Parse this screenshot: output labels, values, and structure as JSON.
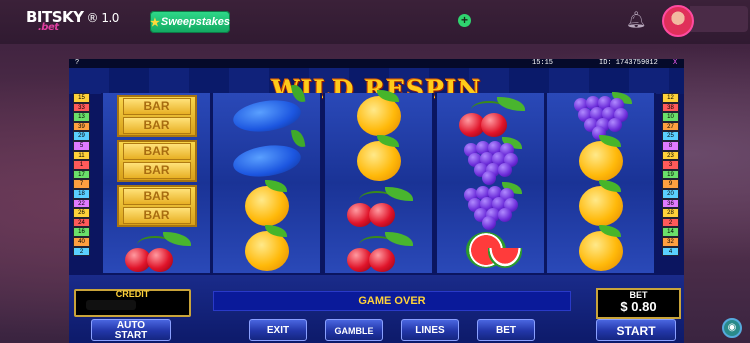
{
  "header": {
    "logo_main": "BITSKY",
    "logo_sub": ".bet",
    "logo_version": "® 1.0",
    "sweepstakes_label": "Sweepstakes",
    "plus_label": "+"
  },
  "game": {
    "status_left": "? ",
    "status_time": "15:15",
    "status_id": "ID: 1743759012",
    "status_close": "X",
    "title": "WILD RESPIN",
    "left_lines": [
      "15",
      "33",
      "13",
      "39",
      "29",
      "5",
      "11",
      "1",
      "17",
      "7",
      "18",
      "22",
      "26",
      "24",
      "16",
      "40",
      "2"
    ],
    "right_lines": [
      "12",
      "38",
      "10",
      "27",
      "25",
      "8",
      "23",
      "3",
      "19",
      "9",
      "20",
      "36",
      "28",
      "2",
      "14",
      "32",
      "4"
    ],
    "line_colors": [
      "#ffd23a",
      "#ff5a5a",
      "#6ae06a",
      "#ffa040",
      "#5ad0ff",
      "#e07aff",
      "#ffd23a",
      "#ff5a5a",
      "#6ae06a",
      "#ffa040",
      "#5ad0ff",
      "#e07aff",
      "#ffd23a",
      "#ff5a5a",
      "#6ae06a",
      "#ffa040",
      "#5ad0ff"
    ],
    "reels": [
      [
        "bar",
        "bar",
        "bar",
        "cherry"
      ],
      [
        "plum",
        "plum",
        "orange",
        "orange"
      ],
      [
        "orange",
        "orange",
        "cherry",
        "cherry"
      ],
      [
        "cherry",
        "grapes",
        "grapes",
        "watermelon"
      ],
      [
        "grapes",
        "orange",
        "orange",
        "orange"
      ]
    ],
    "bar_text": "BAR"
  },
  "panel": {
    "credit_label": "CREDIT",
    "message": "GAME OVER",
    "bet_label": "BET",
    "bet_value": "$ 0.80",
    "buttons": {
      "auto_start_1": "AUTO",
      "auto_start_2": "START",
      "exit": "EXIT",
      "gamble": "GAMBLE",
      "lines": "LINES",
      "bet": "BET",
      "start": "START"
    }
  }
}
